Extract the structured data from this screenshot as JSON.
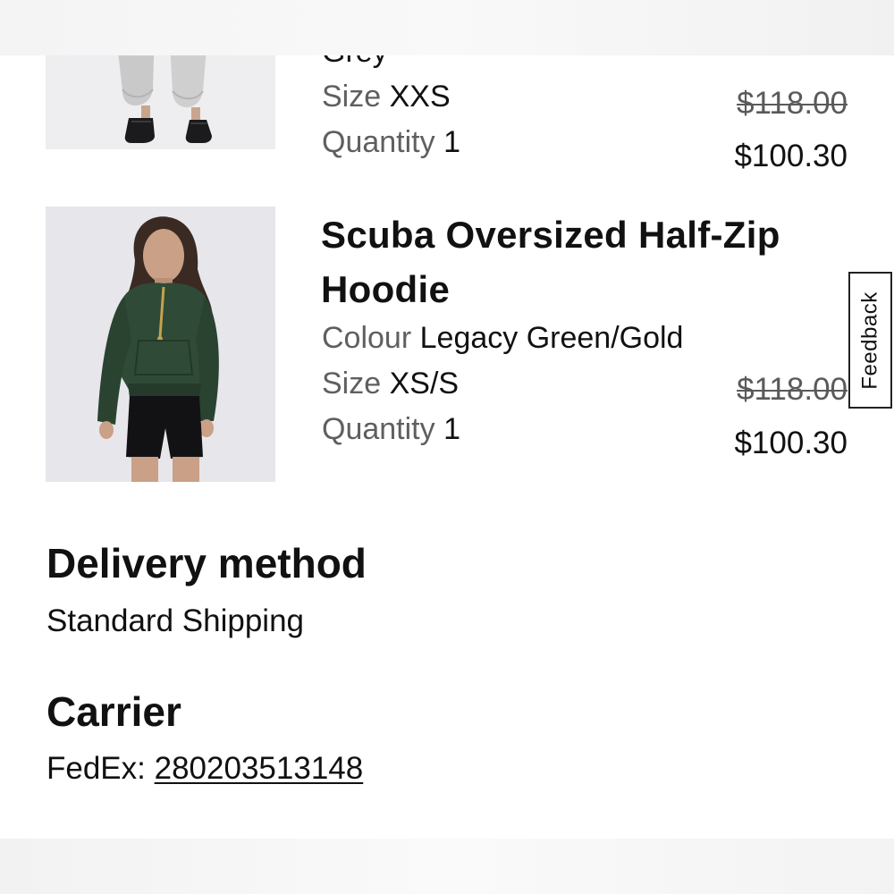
{
  "feedback": {
    "label": "Feedback"
  },
  "items": [
    {
      "colour_value_partial": "Grey",
      "size_key": "Size",
      "size_value": "XXS",
      "quantity_key": "Quantity",
      "quantity_value": "1",
      "original_price": "$118.00",
      "sale_price": "$100.30",
      "thumbnail": "product-photo-joggers"
    },
    {
      "title_line1": "Scuba Oversized Half-Zip",
      "title_line2": "Hoodie",
      "colour_key": "Colour",
      "colour_value": "Legacy Green/Gold",
      "size_key": "Size",
      "size_value": "XS/S",
      "quantity_key": "Quantity",
      "quantity_value": "1",
      "original_price": "$118.00",
      "sale_price": "$100.30",
      "thumbnail": "product-photo-hoodie"
    }
  ],
  "delivery": {
    "heading": "Delivery method",
    "value": "Standard Shipping"
  },
  "carrier": {
    "heading": "Carrier",
    "name": "FedEx:",
    "tracking_number": "280203513148"
  },
  "colors": {
    "hoodie_green": "#2f4a36",
    "text": "#111111",
    "muted": "#5f5f5f"
  }
}
